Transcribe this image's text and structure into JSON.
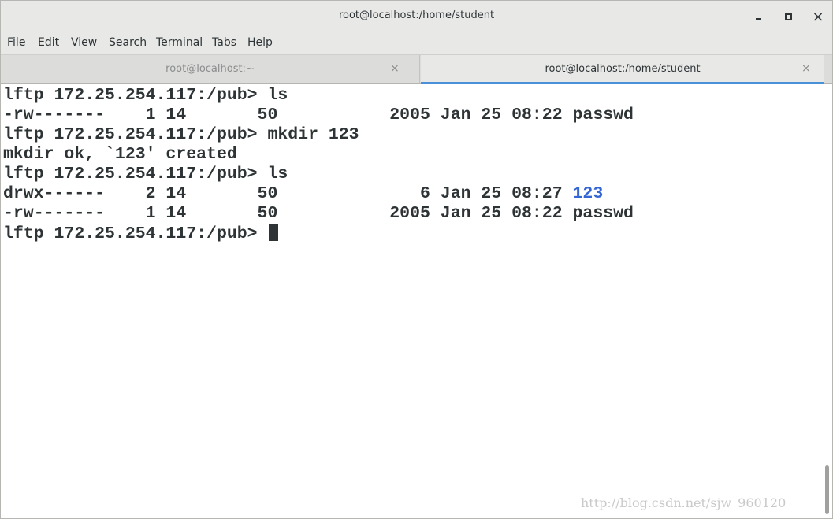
{
  "window": {
    "title": "root@localhost:/home/student",
    "controls": {
      "minimize": "minimize-icon",
      "maximize": "maximize-icon",
      "close": "×"
    }
  },
  "menu": {
    "items": [
      "File",
      "Edit",
      "View",
      "Search",
      "Terminal",
      "Tabs",
      "Help"
    ]
  },
  "tabs": [
    {
      "label": "root@localhost:~",
      "close": "×",
      "active": false
    },
    {
      "label": "root@localhost:/home/student",
      "close": "×",
      "active": true
    }
  ],
  "terminal": {
    "lines": [
      "lftp 172.25.254.117:/pub> ls",
      "-rw-------    1 14       50           2005 Jan 25 08:22 passwd",
      "lftp 172.25.254.117:/pub> mkdir 123",
      "mkdir ok, `123' created",
      "lftp 172.25.254.117:/pub> ls",
      "drwx------    2 14       50              6 Jan 25 08:27 ",
      "-rw-------    1 14       50           2005 Jan 25 08:22 passwd",
      "lftp 172.25.254.117:/pub> "
    ],
    "dir_name": "123",
    "colors": {
      "text": "#2e3436",
      "directory": "#3465d4",
      "background": "#ffffff"
    }
  },
  "watermark": "http://blog.csdn.net/sjw_960120"
}
